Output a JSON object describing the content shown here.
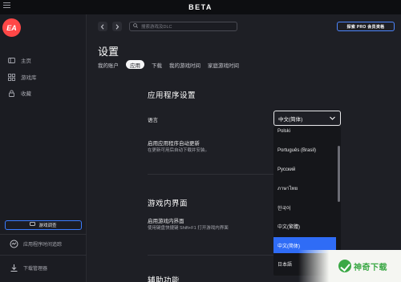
{
  "titlebar": {
    "title": "BETA",
    "menu_icon": "hamburger-icon"
  },
  "sidebar": {
    "logo": "EA",
    "items": [
      {
        "label": "主页",
        "icon": "home-icon"
      },
      {
        "label": "游戏库",
        "icon": "grid-icon"
      },
      {
        "label": "收藏",
        "icon": "lock-icon"
      }
    ],
    "feedback_button": "游戏调查",
    "bottom_items": [
      {
        "label": "应用程序时间追踪",
        "icon": "activity-icon"
      },
      {
        "label": "下载管理器",
        "icon": "download-icon"
      }
    ]
  },
  "header": {
    "back_icon": "chevron-left-icon",
    "forward_icon": "chevron-right-icon",
    "search_placeholder": "搜索游戏及DLC",
    "upgrade_button": "探索 PRO 会员资格"
  },
  "page": {
    "title": "设置",
    "tabs": [
      {
        "label": "我的账户",
        "active": false
      },
      {
        "label": "应用",
        "active": true
      },
      {
        "label": "下载",
        "active": false
      },
      {
        "label": "我的游戏时间",
        "active": false
      },
      {
        "label": "家庭游戏时间",
        "active": false
      }
    ]
  },
  "settings": {
    "app_section_title": "应用程序设置",
    "language_label": "语言",
    "language_value": "中文(简体)",
    "auto_update_label": "启用应用程序自动更新",
    "auto_update_desc": "在更新可用后自动下载并安装。",
    "ingame_section_title": "游戏内界面",
    "ingame_label": "启用游戏内界面",
    "ingame_desc": "使用键盘快捷键 Shift+F1 打开游戏内界面",
    "accessibility_section_title": "辅助功能"
  },
  "language_options": [
    {
      "label": "Polski",
      "selected": false
    },
    {
      "label": "Português (Brasil)",
      "selected": false
    },
    {
      "label": "Русский",
      "selected": false
    },
    {
      "label": "ภาษาไทย",
      "selected": false
    },
    {
      "label": "한국어",
      "selected": false
    },
    {
      "label": "中文(繁體)",
      "selected": false
    },
    {
      "label": "中文(简体)",
      "selected": true
    },
    {
      "label": "日本語",
      "selected": false
    }
  ],
  "watermark": {
    "text": "神奇下载"
  },
  "colors": {
    "accent": "#2f6cf6",
    "brand": "#ff4747",
    "background": "#1e1f25"
  }
}
